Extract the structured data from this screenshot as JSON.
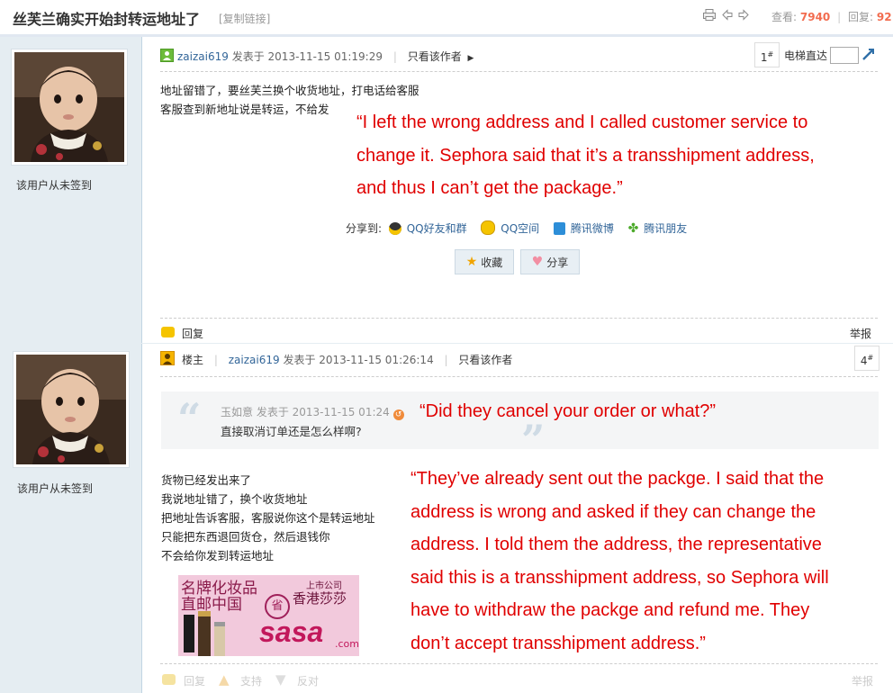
{
  "header": {
    "title": "丝芙兰确实开始封转运地址了",
    "copy_link": "[复制链接]",
    "views_label": "查看:",
    "views": "7940",
    "sep": "|",
    "replies_label": "回复:",
    "replies": "92"
  },
  "sidebar": {
    "sign_note_1": "该用户从未签到",
    "sign_note_2": "该用户从未签到"
  },
  "post1": {
    "author": "zaizai619",
    "posted_at": "发表于 2013-11-15 01:19:29",
    "sep": "|",
    "only_author": "只看该作者",
    "floor": "1",
    "floor_mark": "#",
    "elevator_label": "电梯直达",
    "lines": [
      "地址留错了，要丝芙兰换个收货地址，打电话给客服",
      "客服查到新地址说是转运，不给发"
    ],
    "annotation": [
      "“I left the wrong address and I called customer service to",
      "change it. Sephora said that it’s a transshipment address,",
      "and thus I can’t get the package.”"
    ],
    "share_label": "分享到:",
    "share_links": [
      "QQ好友和群",
      "QQ空间",
      "腾讯微博",
      "腾讯朋友"
    ],
    "favorite_label": "收藏",
    "share_button_label": "分享",
    "reply_label": "回复",
    "report_label": "举报"
  },
  "post2": {
    "role": "楼主",
    "sep": "|",
    "author": "zaizai619",
    "posted_at": "发表于 2013-11-15 01:26:14",
    "only_author": "只看该作者",
    "floor": "4",
    "floor_mark": "#",
    "quote_meta": "玉如意 发表于 2013-11-15 01:24",
    "quote_text": "直接取消订单还是怎么样啊?",
    "quote_annotation": "“Did they cancel your order or what?”",
    "lines": [
      "货物已经发出来了",
      "我说地址错了，换个收货地址",
      "把地址告诉客服，客服说你这个是转运地址",
      "只能把东西退回货仓，然后退钱你",
      "不会给你发到转运地址"
    ],
    "annotation": [
      "“They’ve already sent out the packge. I said that the",
      "address is wrong and asked if they can change the",
      "address. I told them the address, the representative",
      "said this is a transshipment address, so Sephora will",
      "have to withdraw the packge and refund me. They",
      "don’t accept transshipment address.”"
    ],
    "ad": {
      "line1": "名牌化妆品",
      "line2": "直邮中国",
      "badge": "上市公司",
      "brand_cn": "香港莎莎",
      "seal": "省",
      "brand": "sasa",
      "brand_suffix": ".com"
    },
    "reply_label": "回复",
    "support_label": "支持",
    "oppose_label": "反对",
    "report_label": "举报"
  },
  "colors": {
    "accent_link": "#336699",
    "annotation_red": "#e00000",
    "sidebar_bg": "#e5edf2",
    "stat_number": "#f26c4f"
  }
}
